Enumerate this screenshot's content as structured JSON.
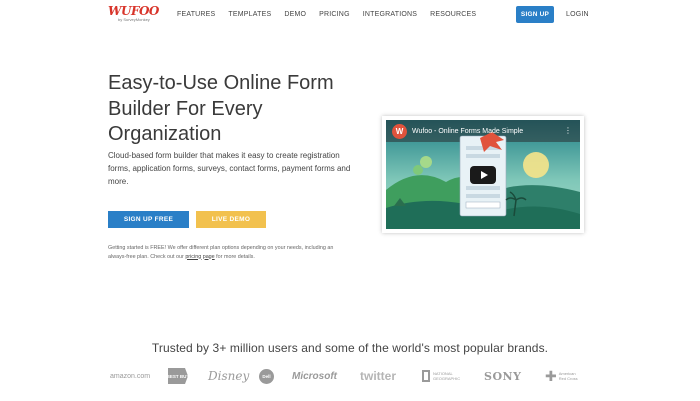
{
  "header": {
    "logo_word": "WUFOO",
    "logo_sub": "by SurveyMonkey",
    "nav": [
      "FEATURES",
      "TEMPLATES",
      "DEMO",
      "PRICING",
      "INTEGRATIONS",
      "RESOURCES"
    ],
    "signup_label": "SIGN UP",
    "login_label": "LOGIN"
  },
  "hero": {
    "title_lines": [
      "Easy-to-Use Online Form",
      "Builder For Every",
      "Organization"
    ],
    "description": "Cloud-based form builder that makes it easy to create registration forms, application forms, surveys, contact forms, payment forms and more.",
    "signup_free_label": "SIGN UP FREE",
    "live_demo_label": "LIVE DEMO",
    "fine_print_before": "Getting started is FREE! We offer different plan options depending on your needs, including an always-free plan. Check out our ",
    "fine_print_link": "pricing page",
    "fine_print_after": " for more details."
  },
  "video": {
    "badge": "W",
    "title": "Wufoo - Online Forms Made Simple",
    "menu_icon": "more-vertical-icon",
    "play_icon": "play-icon"
  },
  "trusted": {
    "heading": "Trusted by 3+ million users and some of the world's most popular brands.",
    "brands": [
      "amazon.com",
      "BEST BUY",
      "Disney",
      "Dell",
      "Microsoft",
      "twitter",
      "NATIONAL GEOGRAPHIC",
      "SONY",
      "American Red Cross"
    ]
  },
  "colors": {
    "brand_red": "#d8342a",
    "primary_blue": "#2a7fc7",
    "demo_yellow": "#f2c14e"
  }
}
